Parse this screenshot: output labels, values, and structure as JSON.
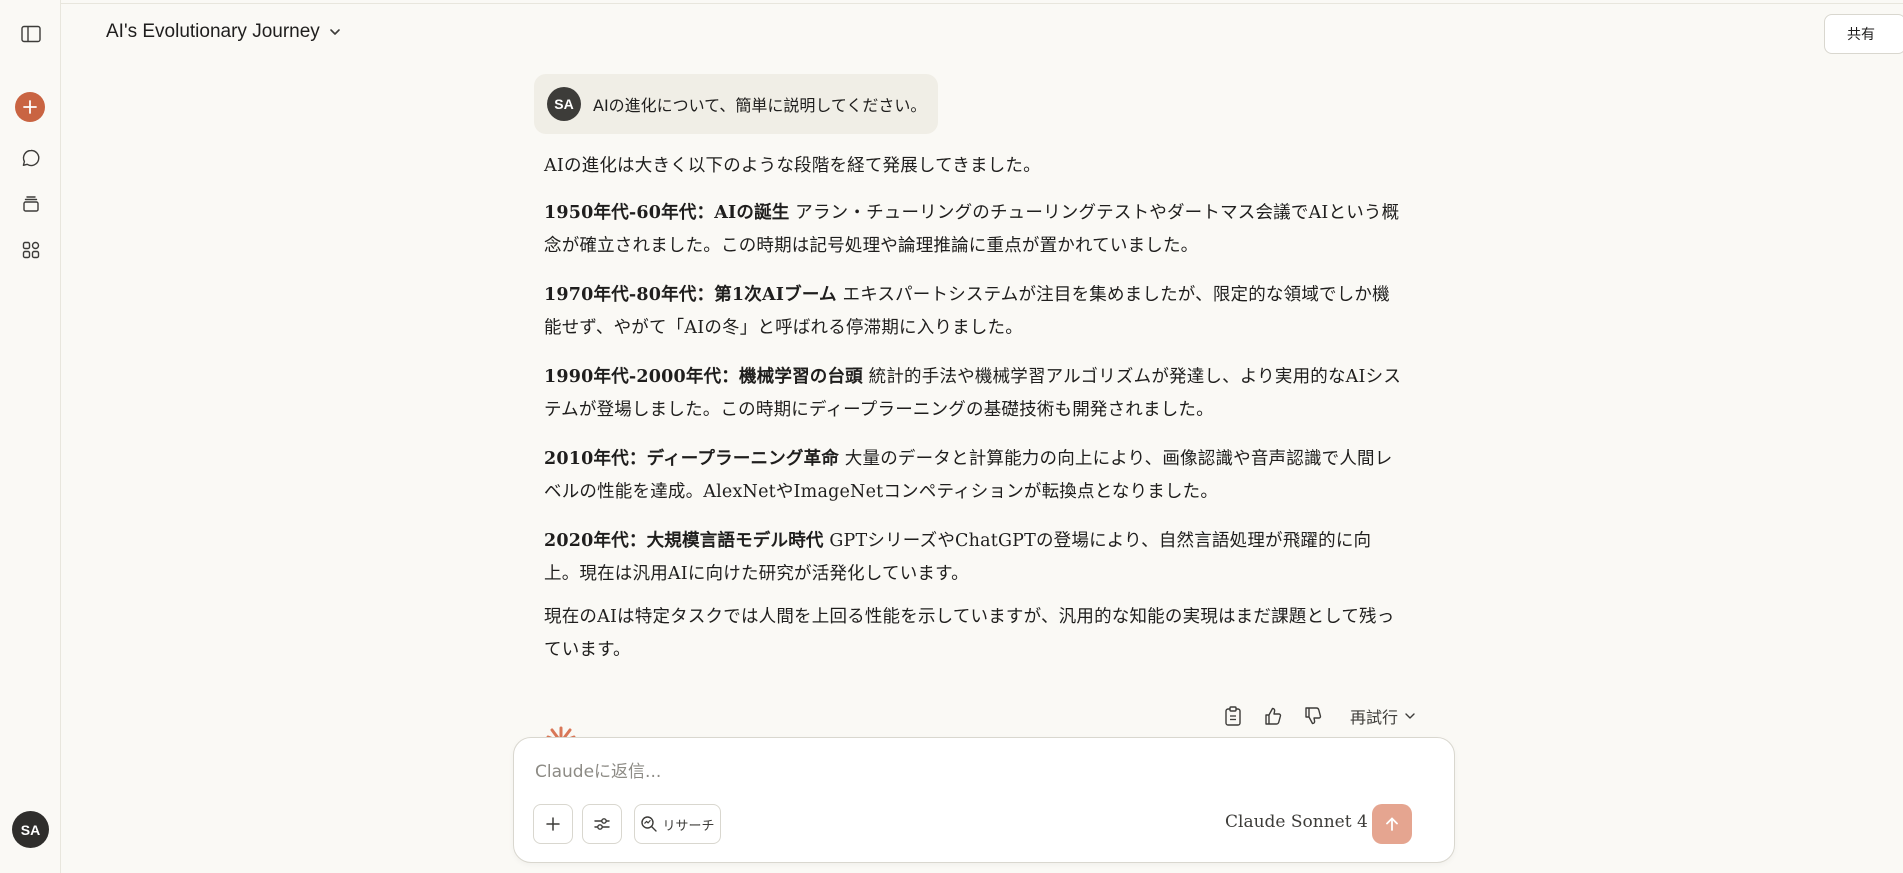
{
  "header": {
    "title": "AI's Evolutionary Journey",
    "share_label": "共有"
  },
  "sidebar": {
    "user_initials": "SA"
  },
  "conversation": {
    "user_initials": "SA",
    "user_message": "AIの進化について、簡単に説明してください。",
    "intro": "AIの進化は大きく以下のような段階を経て発展してきました。",
    "sections": [
      {
        "heading": "1950年代-60年代：AIの誕生",
        "body": "アラン・チューリングのチューリングテストやダートマス会議でAIという概念が確立されました。この時期は記号処理や論理推論に重点が置かれていました。"
      },
      {
        "heading": "1970年代-80年代：第1次AIブーム",
        "body": "エキスパートシステムが注目を集めましたが、限定的な領域でしか機能せず、やがて「AIの冬」と呼ばれる停滞期に入りました。"
      },
      {
        "heading": "1990年代-2000年代：機械学習の台頭",
        "body": "統計的手法や機械学習アルゴリズムが発達し、より実用的なAIシステムが登場しました。この時期にディープラーニングの基礎技術も開発されました。"
      },
      {
        "heading": "2010年代：ディープラーニング革命",
        "body": "大量のデータと計算能力の向上により、画像認識や音声認識で人間レベルの性能を達成。AlexNetやImageNetコンペティションが転換点となりました。"
      },
      {
        "heading": "2020年代：大規模言語モデル時代",
        "body": "GPTシリーズやChatGPTの登場により、自然言語処理が飛躍的に向上。現在は汎用AIに向けた研究が活発化しています。"
      }
    ],
    "conclusion": "現在のAIは特定タスクでは人間を上回る性能を示していますが、汎用的な知能の実現はまだ課題として残っています。"
  },
  "actions": {
    "retry_label": "再試行"
  },
  "composer": {
    "placeholder": "Claudeに返信...",
    "research_label": "リサーチ",
    "model_label": "Claude Sonnet 4"
  },
  "colors": {
    "accent": "#c96442",
    "send_disabled": "#e5a590",
    "background": "#faf9f5"
  }
}
